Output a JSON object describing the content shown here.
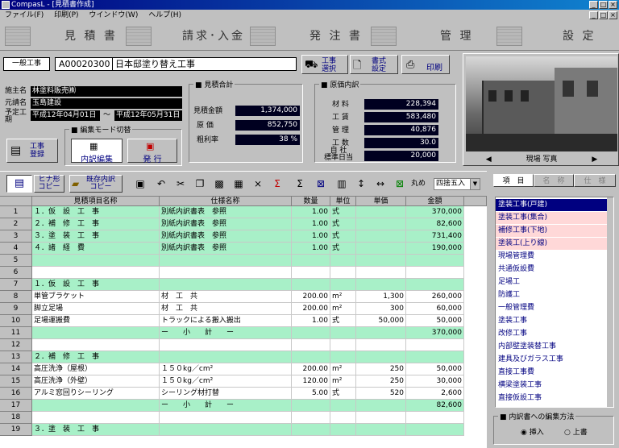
{
  "window": {
    "title": "CompasL - [見積書作成]"
  },
  "menu": [
    "ファイル(F)",
    "印刷(P)",
    "ウインドウ(W)",
    "ヘルプ(H)"
  ],
  "nav": [
    "見 積 書",
    "請求･入金",
    "発 注 書",
    "管 理",
    "設 定"
  ],
  "doc": {
    "tag": "一般工事",
    "number": "A00020300",
    "name": "日本邸塗り替え工事"
  },
  "doc_buttons": {
    "select": "工事\n選択",
    "format": "書式\n設定",
    "print": "印刷"
  },
  "info": {
    "client_label": "施主名",
    "client": "林塗料販売㈱",
    "contractor_label": "元請名",
    "contractor": "玉島建設",
    "period_label": "予定工期",
    "start": "平成12年04月01日",
    "tilde": "～",
    "end": "平成12年05月31日",
    "register_button": "工事\n登録"
  },
  "mode": {
    "title": "編集モード切替",
    "breakdown": "内訳編集",
    "issue": "発 行"
  },
  "totals": {
    "title": "見積合計",
    "rows": [
      {
        "label": "見積金額",
        "value": "1,374,000"
      },
      {
        "label": "原 価",
        "value": "852,750"
      },
      {
        "label": "粗利率",
        "value": "38 %"
      }
    ]
  },
  "cost": {
    "title": "原価内訳",
    "rows": [
      {
        "label": "材 料",
        "value": "228,394"
      },
      {
        "label": "工 賃",
        "value": "583,480"
      },
      {
        "label": "管 理",
        "value": "40,876"
      },
      {
        "label": "工 数",
        "value": "30.0"
      },
      {
        "label": "自 社\n標準日当",
        "value": "20,000"
      }
    ]
  },
  "photo": {
    "caption": "現場 写真"
  },
  "toolbar": {
    "hinagata": "ヒナ形\nコピー",
    "kizon": "既存内訳\nコピー",
    "rounding_label": "丸め",
    "rounding_value": "四捨五入"
  },
  "grid": {
    "headers": [
      "見積項目名称",
      "仕様名称",
      "数量",
      "単位",
      "単価",
      "金額"
    ],
    "rows": [
      {
        "n": "1",
        "name": "１．仮　設　工　事",
        "spec": "別紙内訳書表　参照",
        "qty": "1.00",
        "unit": "式",
        "price": "",
        "amount": "370,000",
        "green": true
      },
      {
        "n": "2",
        "name": "２．補　修　工　事",
        "spec": "別紙内訳書表　参照",
        "qty": "1.00",
        "unit": "式",
        "price": "",
        "amount": "82,600",
        "green": true
      },
      {
        "n": "3",
        "name": "３．塗　装　工　事",
        "spec": "別紙内訳書表　参照",
        "qty": "1.00",
        "unit": "式",
        "price": "",
        "amount": "731,400",
        "green": true
      },
      {
        "n": "4",
        "name": "４．諸　経　費",
        "spec": "別紙内訳書表　参照",
        "qty": "1.00",
        "unit": "式",
        "price": "",
        "amount": "190,000",
        "green": true
      },
      {
        "n": "5",
        "name": "",
        "spec": "",
        "qty": "",
        "unit": "",
        "price": "",
        "amount": "",
        "green": true
      },
      {
        "n": "6",
        "name": "",
        "spec": "",
        "qty": "",
        "unit": "",
        "price": "",
        "amount": "",
        "green": false
      },
      {
        "n": "7",
        "name": "１．仮　設　工　事",
        "spec": "",
        "qty": "",
        "unit": "",
        "price": "",
        "amount": "",
        "green": true
      },
      {
        "n": "8",
        "name": "単管ブラケット",
        "spec": "材　工　共",
        "qty": "200.00",
        "unit": "m²",
        "price": "1,300",
        "amount": "260,000",
        "green": false
      },
      {
        "n": "9",
        "name": "脚立足場",
        "spec": "材　工　共",
        "qty": "200.00",
        "unit": "m²",
        "price": "300",
        "amount": "60,000",
        "green": false
      },
      {
        "n": "10",
        "name": "足場運搬費",
        "spec": "トラックによる搬入搬出",
        "qty": "1.00",
        "unit": "式",
        "price": "50,000",
        "amount": "50,000",
        "green": false
      },
      {
        "n": "11",
        "name": "",
        "spec": "ー　　小　　計　　ー",
        "qty": "",
        "unit": "",
        "price": "",
        "amount": "370,000",
        "green": true
      },
      {
        "n": "12",
        "name": "",
        "spec": "",
        "qty": "",
        "unit": "",
        "price": "",
        "amount": "",
        "green": false
      },
      {
        "n": "13",
        "name": "２．補　修　工　事",
        "spec": "",
        "qty": "",
        "unit": "",
        "price": "",
        "amount": "",
        "green": true
      },
      {
        "n": "14",
        "name": "高圧洗浄（屋根）",
        "spec": "１５０kg／cm²",
        "qty": "200.00",
        "unit": "m²",
        "price": "250",
        "amount": "50,000",
        "green": false
      },
      {
        "n": "15",
        "name": "高圧洗浄（外壁）",
        "spec": "１５０kg／cm²",
        "qty": "120.00",
        "unit": "m²",
        "price": "250",
        "amount": "30,000",
        "green": false
      },
      {
        "n": "16",
        "name": "アルミ窓回りシーリング",
        "spec": "シーリング材打替",
        "qty": "5.00",
        "unit": "式",
        "price": "520",
        "amount": "2,600",
        "green": false
      },
      {
        "n": "17",
        "name": "",
        "spec": "ー　　小　　計　　ー",
        "qty": "",
        "unit": "",
        "price": "",
        "amount": "82,600",
        "green": true
      },
      {
        "n": "18",
        "name": "",
        "spec": "",
        "qty": "",
        "unit": "",
        "price": "",
        "amount": "",
        "green": false
      },
      {
        "n": "19",
        "name": "３．塗　装　工　事",
        "spec": "",
        "qty": "",
        "unit": "",
        "price": "",
        "amount": "",
        "green": true
      }
    ]
  },
  "side": {
    "tabs": [
      "項　目",
      "名　称",
      "仕　様"
    ],
    "items": [
      "塗装工事(戸建)",
      "塗装工事(集合)",
      "補修工事(下地)",
      "塗装工(上り線)",
      "現場管理費",
      "共通仮設費",
      "足場工",
      "防護工",
      "一般管理費",
      "塗装工事",
      "改修工事",
      "内部壁塗装替工事",
      "建具及びガラス工事",
      "直接工事費",
      "横梁塗装工事",
      "直接仮設工事"
    ],
    "selected": 0,
    "mode_title": "内訳書への編集方法",
    "insert": "挿入",
    "overwrite": "上書"
  }
}
